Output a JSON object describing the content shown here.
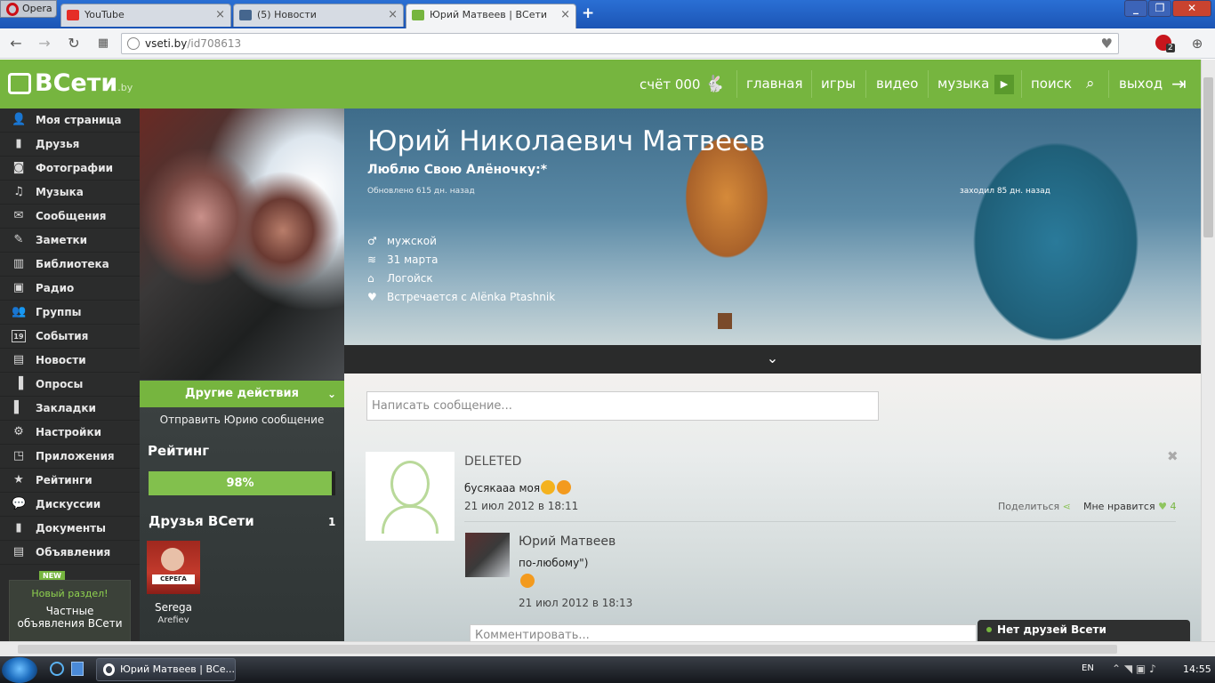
{
  "browser": {
    "menu_label": "Opera",
    "tabs": [
      {
        "label": "YouTube",
        "close": "×",
        "color": "#e52d27"
      },
      {
        "label": "(5) Новости",
        "close": "×",
        "color": "#45668e"
      },
      {
        "label": "Юрий Матвеев | ВСети",
        "close": "×",
        "color": "#76b53f"
      }
    ],
    "new_tab": "+",
    "window_buttons": [
      "_",
      "❐",
      "✕"
    ],
    "url_host": "vseti.by",
    "url_path": "/id708613",
    "badge_count": "2"
  },
  "site": {
    "logo": "ВСети",
    "logo_suffix": ".by",
    "nav": [
      {
        "label": "счёт 000",
        "icon": "rabbit-icon"
      },
      {
        "label": "главная"
      },
      {
        "label": "игры"
      },
      {
        "label": "видео"
      },
      {
        "label": "музыка",
        "icon": "play-icon"
      },
      {
        "label": "поиск",
        "icon": "search-icon"
      },
      {
        "label": "выход",
        "icon": "logout-icon"
      }
    ],
    "accent": "#76b53f"
  },
  "sidebar": {
    "items": [
      {
        "label": "Моя страница",
        "icon": "user-icon",
        "glyph": "👤"
      },
      {
        "label": "Друзья",
        "icon": "book-icon",
        "glyph": "▮"
      },
      {
        "label": "Фотографии",
        "icon": "camera-icon",
        "glyph": "◙"
      },
      {
        "label": "Музыка",
        "icon": "music-icon",
        "glyph": "♫"
      },
      {
        "label": "Сообщения",
        "icon": "envelope-icon",
        "glyph": "✉"
      },
      {
        "label": "Заметки",
        "icon": "note-icon",
        "glyph": "✎"
      },
      {
        "label": "Библиотека",
        "icon": "library-icon",
        "glyph": "▥"
      },
      {
        "label": "Радио",
        "icon": "radio-icon",
        "glyph": "▣"
      },
      {
        "label": "Группы",
        "icon": "group-icon",
        "glyph": "👥"
      },
      {
        "label": "События",
        "icon": "calendar-icon",
        "glyph": "19"
      },
      {
        "label": "Новости",
        "icon": "news-icon",
        "glyph": "▤"
      },
      {
        "label": "Опросы",
        "icon": "poll-icon",
        "glyph": "▐"
      },
      {
        "label": "Закладки",
        "icon": "bookmark-icon",
        "glyph": "▌"
      },
      {
        "label": "Настройки",
        "icon": "gear-icon",
        "glyph": "⚙"
      },
      {
        "label": "Приложения",
        "icon": "apps-icon",
        "glyph": "◳"
      },
      {
        "label": "Рейтинги",
        "icon": "star-icon",
        "glyph": "★"
      },
      {
        "label": "Дискуссии",
        "icon": "chat-icon",
        "glyph": "💬"
      },
      {
        "label": "Документы",
        "icon": "docs-icon",
        "glyph": "▮"
      },
      {
        "label": "Объявления",
        "icon": "ads-icon",
        "glyph": "▤",
        "badge": "NEW"
      }
    ],
    "new_section": {
      "title": "Новый раздел!",
      "text": "Частные объявления ВСети"
    }
  },
  "profile": {
    "name": "Юрий Николаевич Матвеев",
    "status": "Люблю Свою Алёночку:*",
    "updated": "Обновлено 615 дн. назад",
    "last_seen": "заходил 85 дн. назад",
    "info": [
      {
        "text": "мужской",
        "icon": "male-icon",
        "glyph": "♂"
      },
      {
        "text": "31 марта",
        "icon": "cake-icon",
        "glyph": "≋"
      },
      {
        "text": "Логойск",
        "icon": "home-icon",
        "glyph": "⌂"
      },
      {
        "text": "Встречается с Alёnka Ptashnik",
        "icon": "heart-icon",
        "glyph": "♥"
      }
    ],
    "other_actions": "Другие действия",
    "send_message": "Отправить Юрию сообщение",
    "rating_title": "Рейтинг",
    "rating_value": "98%",
    "rating_fraction": 0.98,
    "friends_title": "Друзья ВСети",
    "friends_count": "1",
    "friend": {
      "first": "Serega",
      "last": "Arefiev",
      "sign": "СЕРЕГА"
    }
  },
  "wall": {
    "placeholder": "Написать сообщение...",
    "post": {
      "author": "DELETED",
      "text": "бусякааа моя",
      "date": "21 июл 2012 в 18:11",
      "share": "Поделиться",
      "like": "Мне нравится",
      "likes": "4",
      "close": "✖"
    },
    "reply": {
      "author": "Юрий Матвеев",
      "text": "по-любому\")",
      "date": "21 июл 2012 в 18:13"
    },
    "comment_placeholder": "Комментировать..."
  },
  "chat": {
    "label": "Нет друзей Всети"
  },
  "taskbar": {
    "task": "Юрий Матвеев | ВСе...",
    "lang": "EN",
    "time": "14:55"
  }
}
